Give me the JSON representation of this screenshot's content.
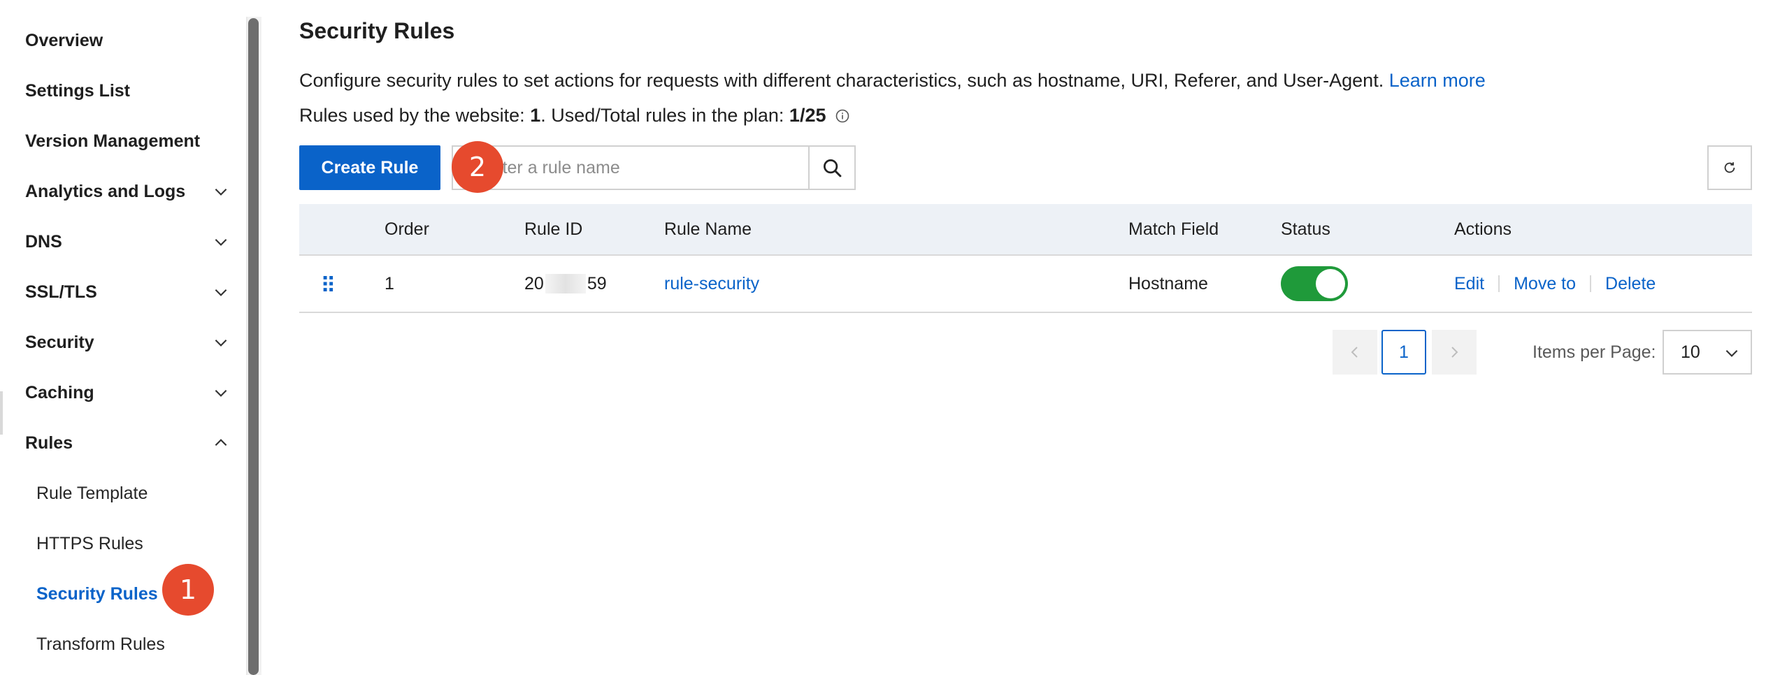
{
  "sidebar": {
    "items": [
      {
        "label": "Overview"
      },
      {
        "label": "Settings List"
      },
      {
        "label": "Version Management"
      },
      {
        "label": "Analytics and Logs"
      },
      {
        "label": "DNS"
      },
      {
        "label": "SSL/TLS"
      },
      {
        "label": "Security"
      },
      {
        "label": "Caching"
      },
      {
        "label": "Rules"
      }
    ],
    "sub_items": [
      {
        "label": "Rule Template"
      },
      {
        "label": "HTTPS Rules"
      },
      {
        "label": "Security Rules"
      },
      {
        "label": "Transform Rules"
      }
    ]
  },
  "badges": {
    "one": "1",
    "two": "2"
  },
  "page": {
    "title": "Security Rules",
    "description": "Configure security rules to set actions for requests with different characteristics, such as hostname, URI, Referer, and User-Agent.",
    "learn_more": "Learn more",
    "usage_prefix": "Rules used by the website: ",
    "usage_used": "1",
    "usage_middle": ". Used/Total rules in the plan: ",
    "usage_plan": "1/25"
  },
  "toolbar": {
    "create_label": "Create Rule",
    "search_placeholder": "Enter a rule name"
  },
  "table": {
    "headers": {
      "order": "Order",
      "rule_id": "Rule ID",
      "rule_name": "Rule Name",
      "match_field": "Match Field",
      "status": "Status",
      "actions": "Actions"
    },
    "rows": [
      {
        "order": "1",
        "rule_id_start": "20",
        "rule_id_end": "59",
        "rule_name": "rule-security",
        "match_field": "Hostname",
        "status_on": true,
        "actions": {
          "edit": "Edit",
          "move": "Move to",
          "delete": "Delete"
        }
      }
    ]
  },
  "pagination": {
    "current_page": "1",
    "items_per_page_label": "Items per Page:",
    "items_per_page_value": "10"
  },
  "colors": {
    "accent": "#0a63c9",
    "toggle_on": "#1f9a3a",
    "badge": "#e64a2e",
    "table_header_bg": "#edf1f6"
  }
}
